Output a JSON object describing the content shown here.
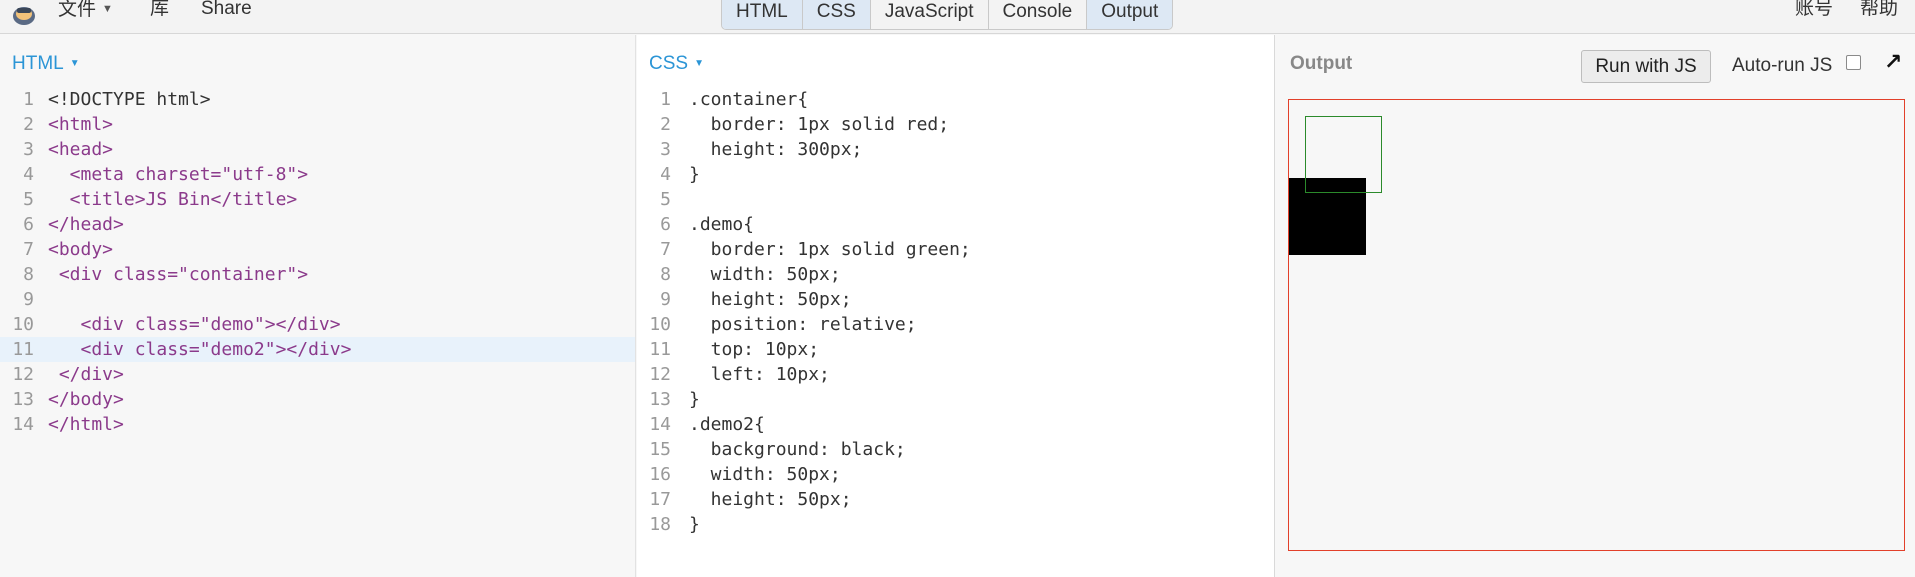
{
  "topbar": {
    "menu": [
      {
        "label": "文件",
        "has_caret": true
      },
      {
        "label": "库"
      },
      {
        "label": "Share"
      }
    ],
    "tabs": [
      {
        "label": "HTML",
        "active": true
      },
      {
        "label": "CSS",
        "active": true
      },
      {
        "label": "JavaScript",
        "active": false
      },
      {
        "label": "Console",
        "active": false
      },
      {
        "label": "Output",
        "active": true
      }
    ],
    "right_menu": [
      {
        "label": "账号"
      },
      {
        "label": "帮助"
      }
    ]
  },
  "html_panel": {
    "label": "HTML",
    "lines": [
      {
        "n": "1",
        "text": "<!DOCTYPE html>"
      },
      {
        "n": "2",
        "text": "<html>"
      },
      {
        "n": "3",
        "text": "<head>"
      },
      {
        "n": "4",
        "text": "  <meta charset=\"utf-8\">"
      },
      {
        "n": "5",
        "text": "  <title>JS Bin</title>"
      },
      {
        "n": "6",
        "text": "</head>"
      },
      {
        "n": "7",
        "text": "<body>"
      },
      {
        "n": "8",
        "text": " <div class=\"container\">"
      },
      {
        "n": "9",
        "text": ""
      },
      {
        "n": "10",
        "text": "   <div class=\"demo\"></div>"
      },
      {
        "n": "11",
        "text": "   <div class=\"demo2\"></div>",
        "highlight": true
      },
      {
        "n": "12",
        "text": " </div>"
      },
      {
        "n": "13",
        "text": "</body>"
      },
      {
        "n": "14",
        "text": "</html>"
      }
    ]
  },
  "css_panel": {
    "label": "CSS",
    "lines": [
      {
        "n": "1",
        "text": ".container{"
      },
      {
        "n": "2",
        "text": "  border: 1px solid red;"
      },
      {
        "n": "3",
        "text": "  height: 300px;"
      },
      {
        "n": "4",
        "text": "}"
      },
      {
        "n": "5",
        "text": ""
      },
      {
        "n": "6",
        "text": ".demo{"
      },
      {
        "n": "7",
        "text": "  border: 1px solid green;"
      },
      {
        "n": "8",
        "text": "  width: 50px;"
      },
      {
        "n": "9",
        "text": "  height: 50px;"
      },
      {
        "n": "10",
        "text": "  position: relative;"
      },
      {
        "n": "11",
        "text": "  top: 10px;"
      },
      {
        "n": "12",
        "text": "  left: 10px;"
      },
      {
        "n": "13",
        "text": "}"
      },
      {
        "n": "14",
        "text": ".demo2{"
      },
      {
        "n": "15",
        "text": "  background: black;"
      },
      {
        "n": "16",
        "text": "  width: 50px;"
      },
      {
        "n": "17",
        "text": "  height: 50px;"
      },
      {
        "n": "18",
        "text": "}"
      }
    ]
  },
  "output_panel": {
    "title": "Output",
    "run_button": "Run with JS",
    "autorun_label": "Auto-run JS",
    "autorun_checked": false,
    "popout_icon": "arrow-up-right-icon"
  },
  "colors": {
    "accent": "#2b95d6",
    "container_border": "#e2402a",
    "demo_border": "#2b8a2b",
    "demo2_background": "#000000"
  }
}
